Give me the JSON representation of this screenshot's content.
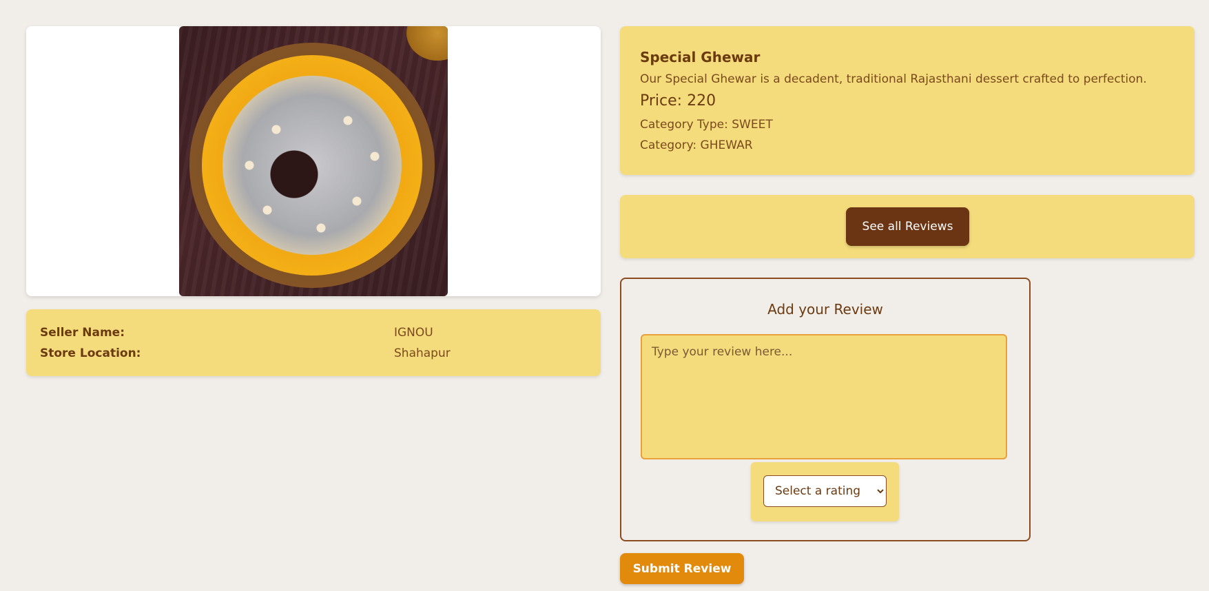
{
  "product": {
    "title": "Special Ghewar",
    "description": "Our Special Ghewar is a decadent, traditional Rajasthani dessert crafted to perfection.",
    "price": "Price: 220",
    "category_type": "Category Type: SWEET",
    "category": "Category: GHEWAR",
    "image_subject": "ghewar-photo"
  },
  "seller": {
    "name_label": "Seller Name:",
    "name_value": "IGNOU",
    "location_label": "Store Location:",
    "location_value": "Shahapur"
  },
  "reviews": {
    "see_all_label": "See all Reviews"
  },
  "add_review": {
    "title": "Add your Review",
    "textarea_placeholder": "Type your review here...",
    "textarea_value": "",
    "rating_selected": "Select a rating",
    "submit_label": "Submit Review"
  },
  "colors": {
    "background": "#f1ede9",
    "card": "#f4dc7c",
    "brown_primary": "#6b3412",
    "orange_accent": "#e28a0c",
    "textarea_border": "#e8a03a"
  }
}
